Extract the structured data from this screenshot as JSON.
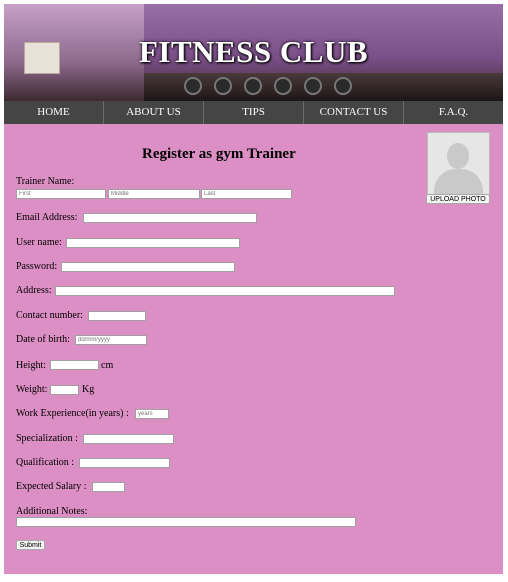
{
  "header": {
    "title": "FITNESS CLUB"
  },
  "nav": {
    "items": [
      "HOME",
      "ABOUT US",
      "TIPS",
      "CONTACT US",
      "F.A.Q."
    ]
  },
  "form": {
    "heading": "Register as gym Trainer",
    "upload_label": "UPLOAD PHOTO",
    "trainer_name_label": "Trainer Name:",
    "first_placeholder": "First",
    "middle_placeholder": "Middle",
    "last_placeholder": "Last",
    "email_label": "Email Address:",
    "username_label": "User name:",
    "password_label": "Password:",
    "address_label": "Address:",
    "contact_label": "Contact number:",
    "dob_label": "Date of birth:",
    "dob_placeholder": "dd/mm/yyyy",
    "height_label": "Height:",
    "height_unit": "cm",
    "weight_label": "Weight:",
    "weight_unit": "Kg",
    "experience_label": "Work Experience(in years) :",
    "experience_placeholder": "years",
    "specialization_label": "Specialization :",
    "qualification_label": "Qualification :",
    "salary_label": "Expected Salary :",
    "notes_label": "Additional Notes:",
    "submit_label": "Submit"
  }
}
